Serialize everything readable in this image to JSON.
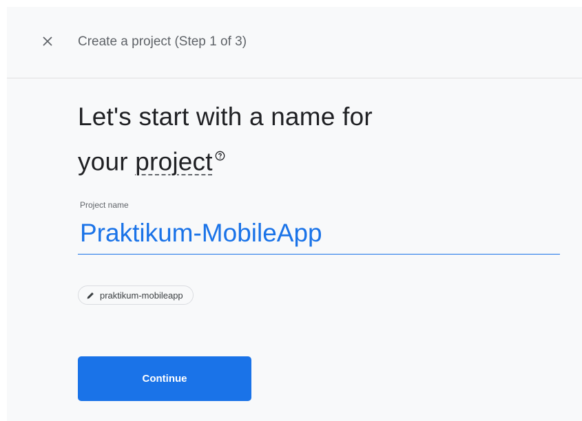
{
  "header": {
    "close_icon": "close-icon",
    "title": "Create a project (Step 1 of 3)"
  },
  "heading": {
    "line1": "Let's start with a name for",
    "line2_prefix": "your ",
    "line2_link": "project",
    "help_icon": "help-circle-icon"
  },
  "form": {
    "label": "Project name",
    "value": "Praktikum-MobileApp"
  },
  "project_id_chip": {
    "icon": "pencil-icon",
    "label": "praktikum-mobileapp"
  },
  "actions": {
    "continue_label": "Continue"
  },
  "colors": {
    "accent": "#1a73e8",
    "background": "#f8f9fa",
    "heading_text": "#202124"
  }
}
